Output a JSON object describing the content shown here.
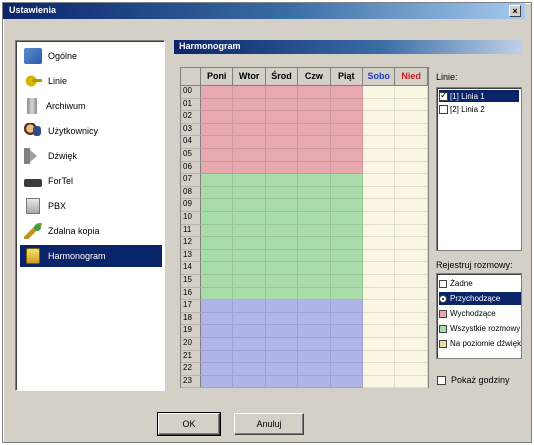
{
  "window": {
    "title": "Ustawienia",
    "close_glyph": "×"
  },
  "sidebar": {
    "items": [
      {
        "label": "Ogólne",
        "icon": "settings-icon"
      },
      {
        "label": "Linie",
        "icon": "phone-line-icon"
      },
      {
        "label": "Archiwum",
        "icon": "archive-icon"
      },
      {
        "label": "Użytkownicy",
        "icon": "users-icon"
      },
      {
        "label": "Dźwięk",
        "icon": "speaker-icon"
      },
      {
        "label": "ForTel",
        "icon": "fortel-icon"
      },
      {
        "label": "PBX",
        "icon": "pbx-icon"
      },
      {
        "label": "Zdalna kopia",
        "icon": "remote-copy-icon"
      },
      {
        "label": "Harmonogram",
        "icon": "schedule-icon"
      }
    ],
    "selected": "Harmonogram"
  },
  "panel": {
    "title": "Harmonogram"
  },
  "schedule": {
    "days": [
      "Poni",
      "Wtor",
      "Środ",
      "Czw",
      "Piąt",
      "Sobo",
      "Nied"
    ],
    "hours": [
      "00",
      "01",
      "02",
      "03",
      "04",
      "05",
      "06",
      "07",
      "08",
      "09",
      "10",
      "11",
      "12",
      "13",
      "14",
      "15",
      "16",
      "17",
      "18",
      "19",
      "20",
      "21",
      "22",
      "23"
    ],
    "blocks": [
      {
        "from_hour": 0,
        "to_hour": 7,
        "days": [
          0,
          1,
          2,
          3,
          4
        ],
        "color": "#e8a8b0"
      },
      {
        "from_hour": 7,
        "to_hour": 17,
        "days": [
          0,
          1,
          2,
          3,
          4
        ],
        "color": "#a8dca8"
      },
      {
        "from_hour": 17,
        "to_hour": 24,
        "days": [
          0,
          1,
          2,
          3,
          4
        ],
        "color": "#b0b4e8"
      }
    ],
    "weekend_color": "#fbf6e2"
  },
  "lines": {
    "label": "Linie:",
    "items": [
      {
        "label": "[1] Linia 1",
        "checked": true,
        "selected": true
      },
      {
        "label": "[2] Linia 2",
        "checked": false,
        "selected": false
      }
    ]
  },
  "registration": {
    "label": "Rejestruj rozmowy:",
    "items": [
      {
        "label": "Żadne",
        "swatch": "#ffffff",
        "kind": "check"
      },
      {
        "label": "Przychodzące",
        "swatch": "#ffffff",
        "kind": "radio",
        "selected": true
      },
      {
        "label": "Wychodzące",
        "swatch": "#e8a8b0",
        "kind": "check"
      },
      {
        "label": "Wszystkie rozmowy",
        "swatch": "#a8dca8",
        "kind": "check"
      },
      {
        "label": "Na poziomie dźwięku",
        "swatch": "#e8e0a0",
        "kind": "check"
      }
    ]
  },
  "show_hours": {
    "label": "Pokaż godziny",
    "checked": false
  },
  "buttons": {
    "ok": "OK",
    "cancel": "Anuluj"
  }
}
